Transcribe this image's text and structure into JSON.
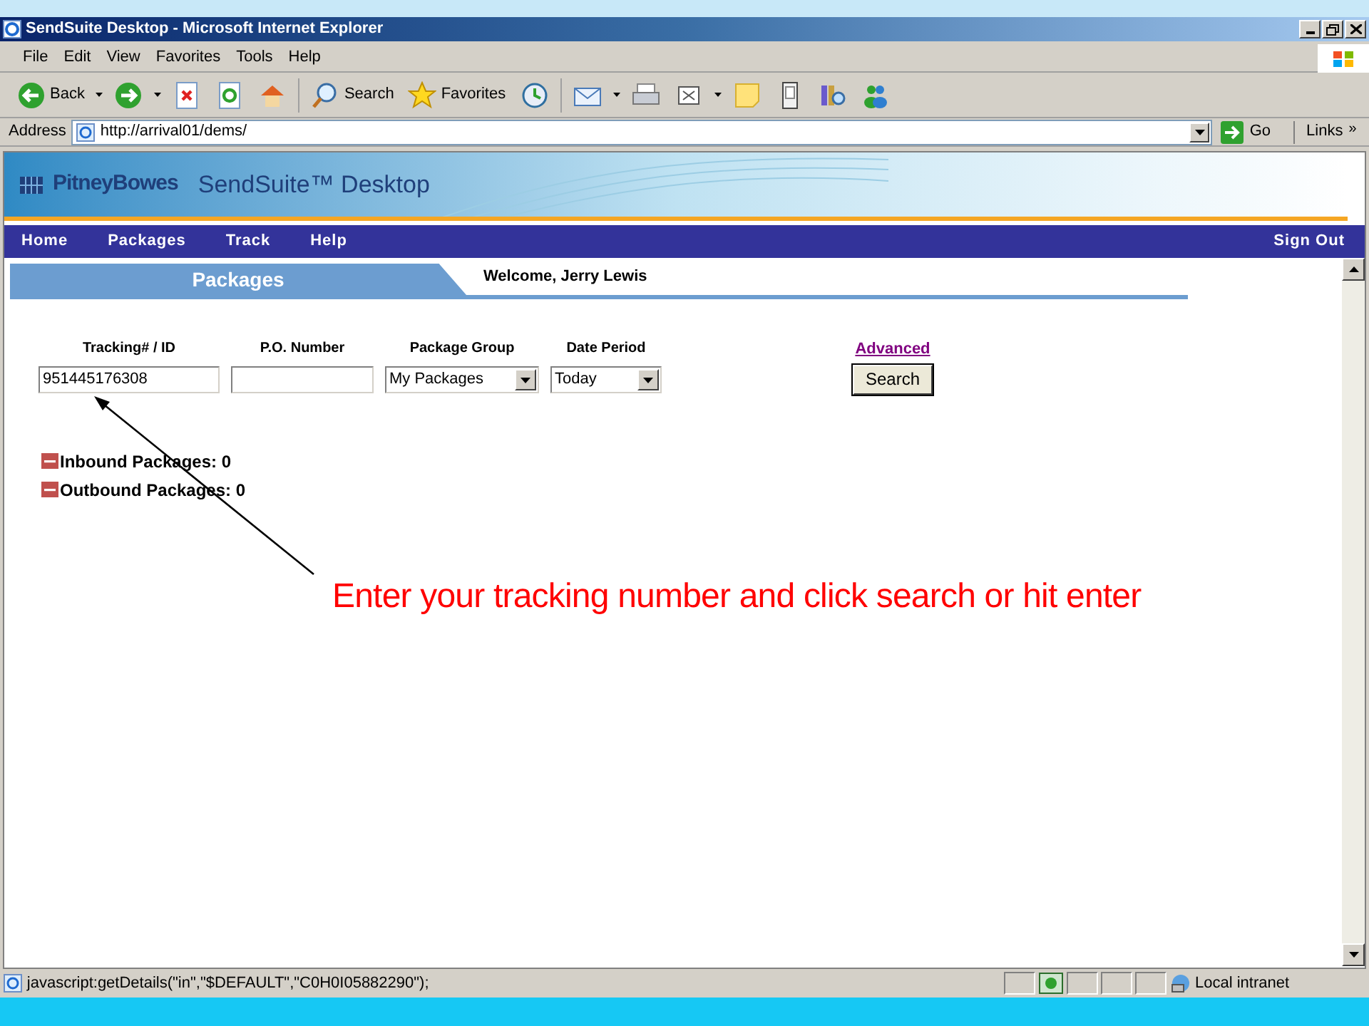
{
  "window": {
    "title": "SendSuite Desktop - Microsoft Internet Explorer"
  },
  "menu_bar": [
    "File",
    "Edit",
    "View",
    "Favorites",
    "Tools",
    "Help"
  ],
  "toolbar": [
    {
      "kind": "back",
      "label": "Back"
    },
    {
      "kind": "forward"
    },
    {
      "kind": "stop"
    },
    {
      "kind": "refresh"
    },
    {
      "kind": "home"
    },
    {
      "kind": "search",
      "label": "Search"
    },
    {
      "kind": "favorites",
      "label": "Favorites"
    },
    {
      "kind": "history"
    },
    {
      "kind": "mail"
    },
    {
      "kind": "print"
    },
    {
      "kind": "edit"
    },
    {
      "kind": "note"
    },
    {
      "kind": "device"
    },
    {
      "kind": "research"
    },
    {
      "kind": "messenger"
    }
  ],
  "address_bar": {
    "label": "Address",
    "url": "http://arrival01/dems/",
    "go": "Go",
    "links": "Links",
    "chevron": "»"
  },
  "banner": {
    "brand": "PitneyBowes",
    "product": "SendSuite™ Desktop"
  },
  "nav": {
    "items": [
      "Home",
      "Packages",
      "Track",
      "Help"
    ],
    "sign_out": "Sign Out"
  },
  "header": {
    "title": "Packages",
    "welcome": "Welcome, Jerry Lewis"
  },
  "form": {
    "fields": [
      {
        "kind": "text",
        "label": "Tracking# / ID",
        "value": "951445176308"
      },
      {
        "kind": "text",
        "label": "P.O. Number"
      },
      {
        "kind": "select",
        "label": "Package Group",
        "value": "My Packages"
      },
      {
        "kind": "select",
        "label": "Date Period",
        "value": "Today"
      }
    ],
    "advanced": "Advanced",
    "search_button": "Search"
  },
  "sections": [
    {
      "label": "Inbound Packages: 0",
      "expanded": true
    },
    {
      "label": "Outbound Packages: 0",
      "expanded": true
    }
  ],
  "annotation": "Enter your tracking number and click search or hit enter",
  "status_bar": {
    "text": "javascript:getDetails(\"in\",\"$DEFAULT\",\"C0H0I05882290\");",
    "zone": "Local intranet"
  }
}
